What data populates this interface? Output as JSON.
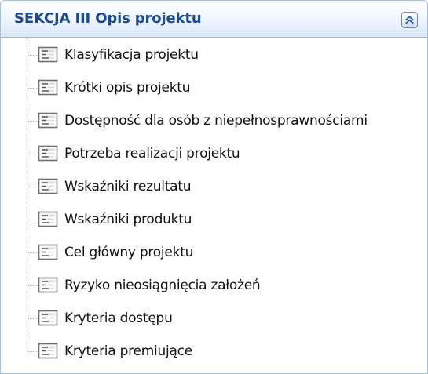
{
  "panel": {
    "title": "SEKCJA III Opis projektu",
    "collapse_icon": "double-chevron-up-icon",
    "colors": {
      "title": "#1e4b8f",
      "border": "#a9bfd6",
      "header_gradient_end": "#dbe8f8"
    }
  },
  "tree": {
    "item_icon": "form-list-icon",
    "items": [
      {
        "label": "Klasyfikacja projektu"
      },
      {
        "label": "Krótki opis projektu"
      },
      {
        "label": "Dostępność dla osób z niepełnosprawnościami"
      },
      {
        "label": "Potrzeba realizacji projektu"
      },
      {
        "label": "Wskaźniki rezultatu"
      },
      {
        "label": "Wskaźniki produktu"
      },
      {
        "label": "Cel główny projektu"
      },
      {
        "label": "Ryzyko nieosiągnięcia założeń"
      },
      {
        "label": "Kryteria dostępu"
      },
      {
        "label": "Kryteria premiujące"
      }
    ]
  }
}
